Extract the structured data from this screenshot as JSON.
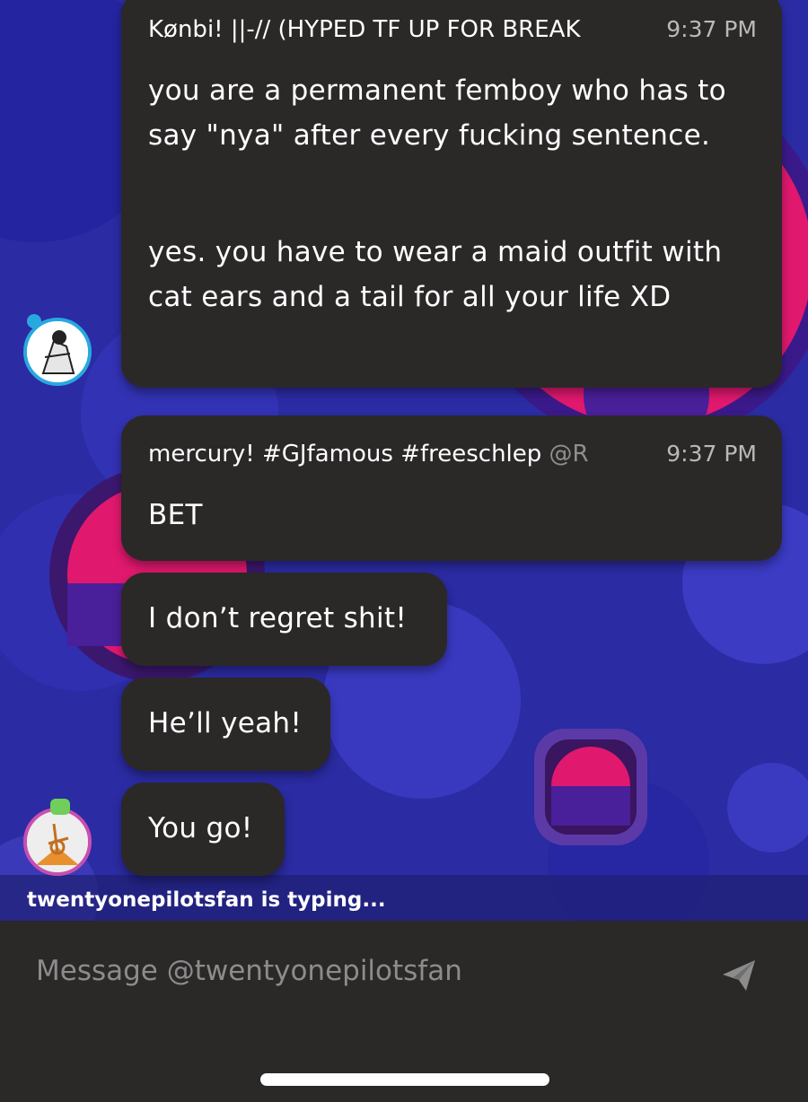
{
  "conversation": {
    "partner": "twentyonepilotsfan",
    "messages": [
      {
        "author": "Kønbi! ||-// (HYPED TF UP FOR BREAK",
        "time": "9:37 PM",
        "paragraphs": [
          "you are a permanent femboy who has to say \"nya\" after every fucking sentence.",
          "yes. you have to wear a maid outfit with cat ears and a tail for all your life XD"
        ]
      },
      {
        "author": "mercury!  #GJfamous #freeschlep",
        "mention": "@R",
        "time": "9:37 PM",
        "text": "BET"
      },
      {
        "text": "I don’t regret shit!"
      },
      {
        "text": "He’ll yeah!"
      },
      {
        "text": "You go!"
      }
    ]
  },
  "typing_indicator": "twentyonepilotsfan is typing...",
  "composer": {
    "placeholder": "Message @twentyonepilotsfan",
    "value": ""
  },
  "colors": {
    "background": "#2a2a9c",
    "bubble": "#2b2828",
    "blob_pink": "#e0186e",
    "blob_purple": "#4a1f9a"
  },
  "icons": {
    "send": "paper-plane-icon"
  }
}
